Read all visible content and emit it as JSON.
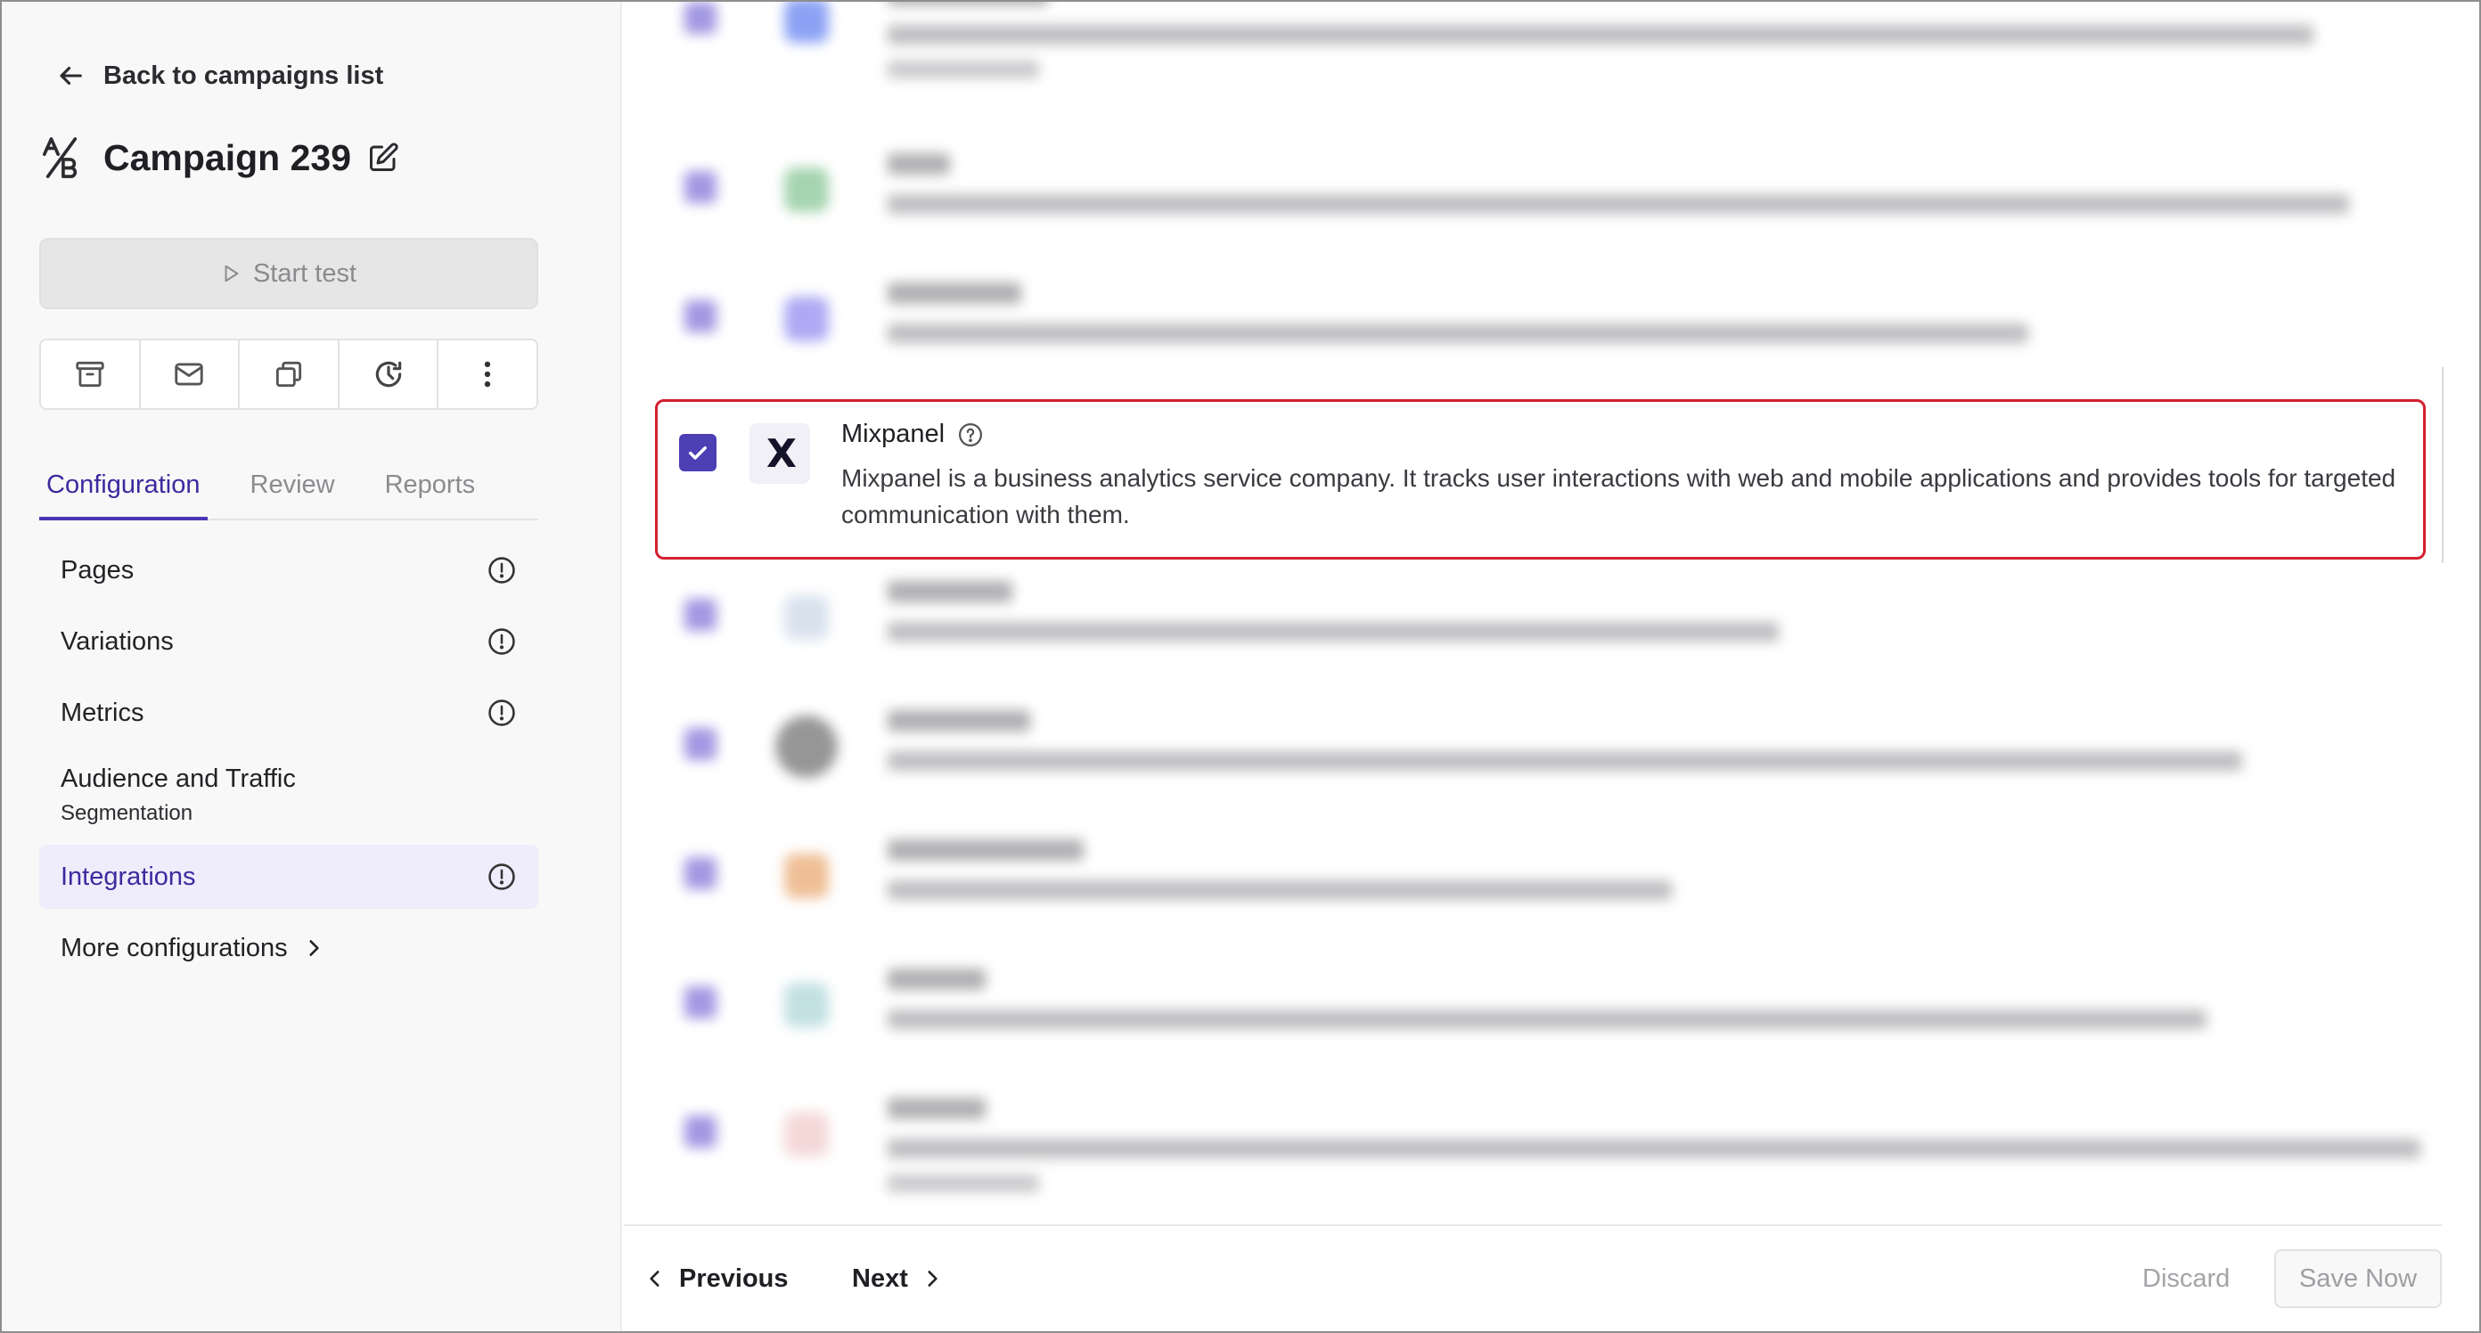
{
  "sidebar": {
    "back_label": "Back to campaigns list",
    "campaign_title": "Campaign 239",
    "start_button": "Start test",
    "toolbar_icons": [
      "archive-icon",
      "mail-icon",
      "copy-icon",
      "history-icon",
      "more-vertical-icon"
    ],
    "tabs": [
      {
        "label": "Configuration",
        "active": true
      },
      {
        "label": "Review",
        "active": false
      },
      {
        "label": "Reports",
        "active": false
      }
    ],
    "nav": {
      "pages": "Pages",
      "variations": "Variations",
      "metrics": "Metrics",
      "audience": "Audience and Traffic",
      "audience_sub": "Segmentation",
      "integrations": "Integrations",
      "more": "More configurations"
    }
  },
  "integration": {
    "name": "Mixpanel",
    "description": "Mixpanel is a business analytics service company. It tracks user interactions with web and mobile applications and provides tools for targeted communication with them.",
    "checked": true
  },
  "footer": {
    "previous": "Previous",
    "next": "Next",
    "discard": "Discard",
    "save": "Save Now"
  },
  "colors": {
    "accent": "#4d3fb4",
    "highlight_border": "#d32030",
    "active_nav_bg": "#efedfb"
  }
}
